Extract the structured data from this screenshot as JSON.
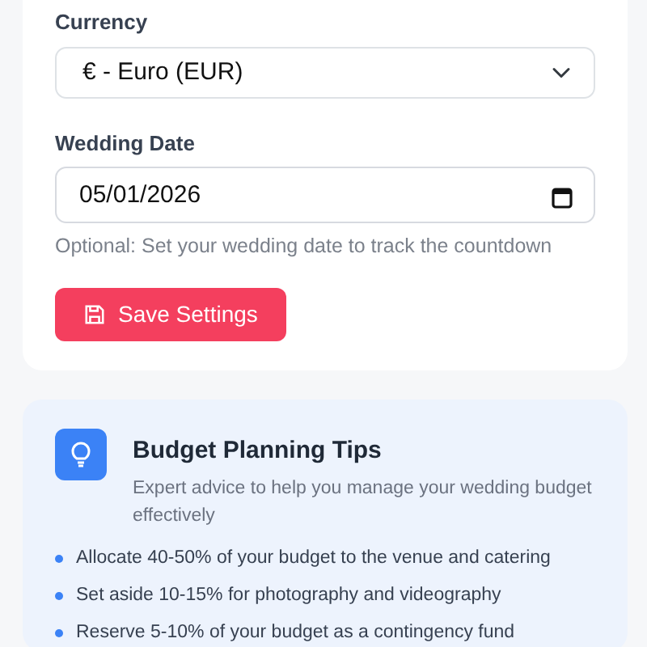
{
  "settings": {
    "currency": {
      "label": "Currency",
      "value": "€ - Euro (EUR)"
    },
    "wedding_date": {
      "label": "Wedding Date",
      "value": "05/01/2026",
      "help": "Optional: Set your wedding date to track the countdown"
    },
    "save_button": "Save Settings"
  },
  "tips": {
    "title": "Budget Planning Tips",
    "subtitle": "Expert advice to help you manage your wedding budget effectively",
    "items": [
      "Allocate 40-50% of your budget to the venue and catering",
      "Set aside 10-15% for photography and videography",
      "Reserve 5-10% of your budget as a contingency fund"
    ]
  }
}
